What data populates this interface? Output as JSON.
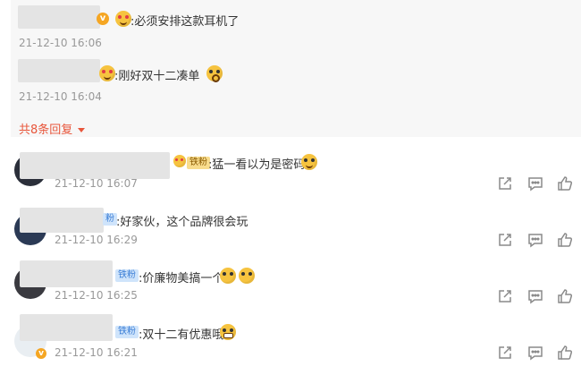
{
  "sub_replies": [
    {
      "text": ":必须安排这款耳机了",
      "time": "21-12-10 16:06"
    },
    {
      "text": ":刚好双十二凑单",
      "time": "21-12-10 16:04"
    }
  ],
  "more_replies": "共8条回复",
  "comments": [
    {
      "badge": "铁粉",
      "text": ":猛一看以为是密码",
      "time": "21-12-10 16:07"
    },
    {
      "badge": "粉",
      "text": ":好家伙，这个品牌很会玩",
      "time": "21-12-10 16:29"
    },
    {
      "badge": "铁粉",
      "text": ":价廉物美搞一个",
      "time": "21-12-10 16:25"
    },
    {
      "badge": "铁粉",
      "text": ":双十二有优惠哦",
      "time": "21-12-10 16:21"
    }
  ],
  "icons": {
    "share": "share-icon",
    "comment": "comment-icon",
    "like": "thumbs-up-icon",
    "expand": "caret-down-icon"
  },
  "colors": {
    "accent": "#e8563b",
    "sub_bg": "#f7f7f7",
    "time": "#999999",
    "badge_blue": "#cfe4fb",
    "badge_gold": "#f8dc8c"
  }
}
